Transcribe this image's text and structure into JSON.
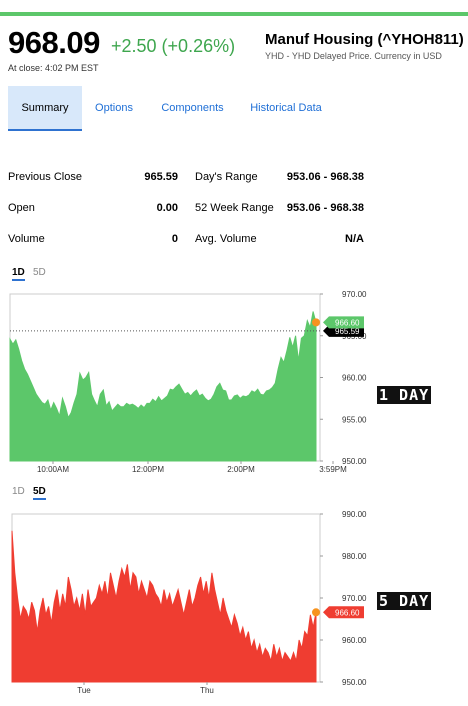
{
  "quote": {
    "price": "968.09",
    "change": "+2.50 (+0.26%)",
    "at_close": "At close: 4:02 PM EST",
    "name": "Manuf Housing (^YHOH811)",
    "source": "YHD - YHD Delayed Price. Currency in USD"
  },
  "tabs": [
    "Summary",
    "Options",
    "Components",
    "Historical Data"
  ],
  "stats": {
    "left": [
      {
        "label": "Previous Close",
        "value": "965.59"
      },
      {
        "label": "Open",
        "value": "0.00"
      },
      {
        "label": "Volume",
        "value": "0"
      }
    ],
    "right": [
      {
        "label": "Day's Range",
        "value": "953.06 - 968.38"
      },
      {
        "label": "52 Week Range",
        "value": "953.06 - 968.38"
      },
      {
        "label": "Avg. Volume",
        "value": "N/A"
      }
    ]
  },
  "badges": {
    "one_day": "1 DAY",
    "five_day": "5 DAY"
  },
  "colors": {
    "up": "#5cc76a",
    "down": "#ef3d31",
    "accent": "#2e72d0",
    "marker": "#f7931e"
  },
  "chart_data": [
    {
      "type": "area",
      "range_tabs": [
        "1D",
        "5D"
      ],
      "active_tab": "1D",
      "x_ticks": [
        "10:00AM",
        "12:00PM",
        "2:00PM",
        "3:59PM"
      ],
      "y_ticks": [
        "970.00",
        "965.00",
        "960.00",
        "955.00",
        "950.00"
      ],
      "ylim": [
        950,
        970
      ],
      "current_label": "966.60",
      "previous_close_label": "965.59",
      "series": [
        {
          "values": [
            964.6,
            964.0,
            964.5,
            963.4,
            962.0,
            961.0,
            960.4,
            959.6,
            958.8,
            958.0,
            957.5,
            957.0,
            956.8,
            957.3,
            956.1,
            957.0,
            956.3,
            955.4,
            957.5,
            956.5,
            955.2,
            955.8,
            957.0,
            958.0,
            960.5,
            959.7,
            960.0,
            960.6,
            958.0,
            957.2,
            956.5,
            958.0,
            958.5,
            956.6,
            957.1,
            956.0,
            956.4,
            956.8,
            956.5,
            956.5,
            956.9,
            956.7,
            956.8,
            956.6,
            956.3,
            956.7,
            956.4,
            956.9,
            956.9,
            957.4,
            957.1,
            957.7,
            957.2,
            957.5,
            957.8,
            958.6,
            958.5,
            958.9,
            959.2,
            958.6,
            958.0,
            958.2,
            957.8,
            958.2,
            958.5,
            957.8,
            958.0,
            957.5,
            957.2,
            957.4,
            958.0,
            958.9,
            959.3,
            958.5,
            958.4,
            957.3,
            957.3,
            957.8,
            957.9,
            957.5,
            957.8,
            957.7,
            957.9,
            958.4,
            958.2,
            958.6,
            958.0,
            957.9,
            958.4,
            958.5,
            958.8,
            959.3,
            961.0,
            962.4,
            961.8,
            963.2,
            964.8,
            963.6,
            965.0,
            962.0,
            964.7,
            965.0,
            966.8,
            966.0,
            967.9,
            966.6
          ]
        }
      ]
    },
    {
      "type": "area",
      "range_tabs": [
        "1D",
        "5D"
      ],
      "active_tab": "5D",
      "x_ticks": [
        "Tue",
        "Thu"
      ],
      "y_ticks": [
        "990.00",
        "980.00",
        "970.00",
        "960.00",
        "950.00"
      ],
      "ylim": [
        950,
        990
      ],
      "current_label": "966.60",
      "series": [
        {
          "values": [
            986,
            976,
            970,
            965,
            968,
            967,
            965,
            969,
            967,
            962,
            967,
            970,
            966,
            968,
            964,
            969,
            972,
            967,
            971,
            968,
            975,
            972,
            968,
            970,
            967,
            971,
            966,
            972,
            968,
            969,
            970,
            973,
            971,
            974,
            970,
            976,
            973,
            970,
            974,
            977,
            975,
            978,
            972,
            976,
            975,
            971,
            974,
            972,
            970,
            974,
            973,
            971,
            970,
            968,
            972,
            969,
            971,
            968,
            970,
            972,
            969,
            966,
            969,
            972,
            968,
            970,
            973,
            975,
            971,
            974,
            970,
            976,
            972,
            969,
            966,
            970,
            967,
            965,
            963,
            966,
            964,
            961,
            963,
            960,
            962,
            958,
            960,
            957,
            959,
            956,
            958,
            957,
            955,
            959,
            956,
            958,
            955,
            957,
            956,
            955,
            957,
            955,
            960,
            958,
            962,
            961,
            966,
            963,
            966.6
          ]
        }
      ]
    }
  ]
}
